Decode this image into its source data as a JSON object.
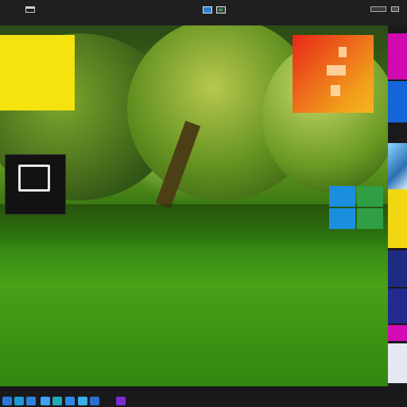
{
  "topbar": {
    "icons": [
      "menu-icon",
      "picture-icon",
      "picture-icon",
      "window-control-icon",
      "window-control-icon"
    ]
  },
  "desktop": {
    "background": "park-lawn-wallpaper",
    "tiles": [
      {
        "name": "yellow-tile",
        "color": "#f5e20e"
      },
      {
        "name": "media-tile",
        "color": "#121212",
        "icon": "folder-icon"
      },
      {
        "name": "office-logo-tile",
        "color": "#e8271a"
      },
      {
        "name": "windows-logo-tile",
        "colors": [
          "#1a8fe0",
          "#2f9e45",
          "#1a8fe0",
          "#2f9e45"
        ]
      }
    ]
  },
  "right_strip": {
    "tiles": [
      {
        "name": "magenta-tile",
        "color": "#d10ab0"
      },
      {
        "name": "blue-tile",
        "color": "#1565d8"
      },
      {
        "name": "image-tile",
        "color": "#2b6fb2"
      },
      {
        "name": "yellow-tile",
        "color": "#f0d613"
      },
      {
        "name": "navy-tile",
        "color": "#1d2b83"
      },
      {
        "name": "navy-tile",
        "color": "#23298e"
      },
      {
        "name": "magenta-tile",
        "color": "#d30ab5"
      },
      {
        "name": "white-tile",
        "color": "#e7e7f2"
      }
    ]
  },
  "taskbar": {
    "items": [
      {
        "name": "taskbar-app-1",
        "color": "#2b78d9"
      },
      {
        "name": "taskbar-app-2",
        "color": "#1d9ad6"
      },
      {
        "name": "taskbar-app-3",
        "color": "#2f7fe0"
      },
      {
        "name": "taskbar-app-4",
        "color": "#3da0f0"
      },
      {
        "name": "taskbar-app-5",
        "color": "#1fa7b6"
      },
      {
        "name": "taskbar-app-6",
        "color": "#2d86e8"
      },
      {
        "name": "taskbar-app-7",
        "color": "#35b0e8"
      },
      {
        "name": "taskbar-app-8",
        "color": "#2a6fd0"
      },
      {
        "name": "taskbar-app-9",
        "color": "#7c2bd1"
      }
    ]
  }
}
